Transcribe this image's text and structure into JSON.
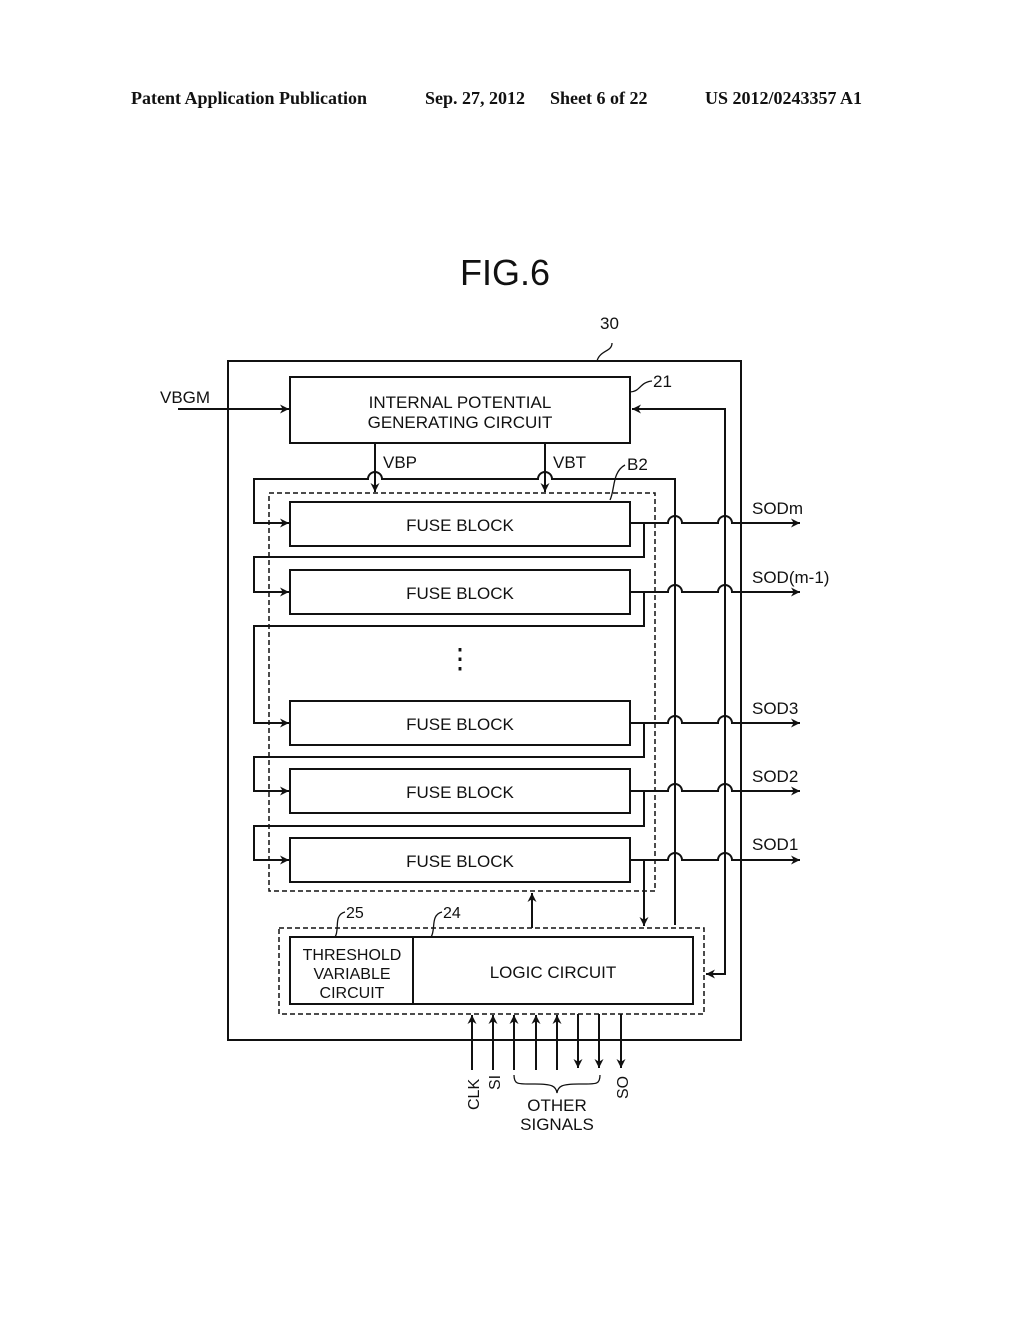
{
  "header": {
    "publication": "Patent Application Publication",
    "date": "Sep. 27, 2012",
    "sheet": "Sheet 6 of 22",
    "number": "US 2012/0243357 A1"
  },
  "figure": {
    "title": "FIG.6",
    "ref_outer": "30",
    "ref_ipgc": "21",
    "ref_block_group": "B2",
    "ref_logic": "24",
    "ref_threshold": "25",
    "input_vbgm": "VBGM",
    "ipgc_line1": "INTERNAL POTENTIAL",
    "ipgc_line2": "GENERATING CIRCUIT",
    "signal_vbp": "VBP",
    "signal_vbt": "VBT",
    "fuse_blocks": [
      {
        "label": "FUSE BLOCK",
        "output": "SODm"
      },
      {
        "label": "FUSE BLOCK",
        "output": "SOD(m-1)"
      },
      {
        "label": "FUSE BLOCK",
        "output": "SOD3"
      },
      {
        "label": "FUSE BLOCK",
        "output": "SOD2"
      },
      {
        "label": "FUSE BLOCK",
        "output": "SOD1"
      }
    ],
    "ellipsis": "⋮",
    "threshold_line1": "THRESHOLD",
    "threshold_line2": "VARIABLE",
    "threshold_line3": "CIRCUIT",
    "logic_label": "LOGIC CIRCUIT",
    "sig_clk": "CLK",
    "sig_si": "SI",
    "sig_so": "SO",
    "other_line1": "OTHER",
    "other_line2": "SIGNALS"
  }
}
